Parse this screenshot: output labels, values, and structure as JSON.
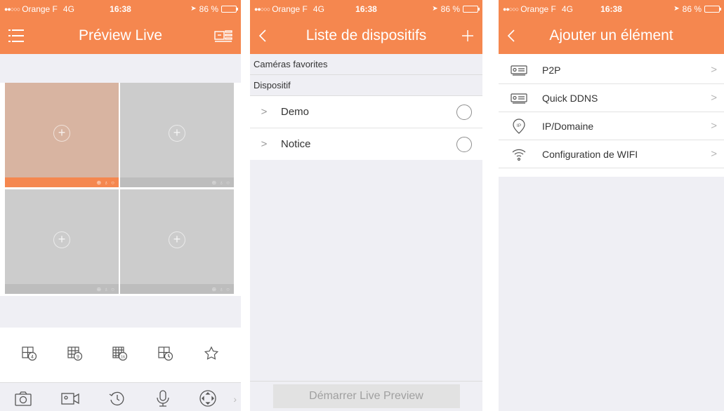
{
  "status": {
    "carrier": "Orange F",
    "network": "4G",
    "time": "16:38",
    "battery": "86 %",
    "signal_dots": "●●○○○"
  },
  "screen1": {
    "title": "Préview Live",
    "menu_icon": "list-menu-icon",
    "right_icon": "device-list-icon",
    "tiles": [
      {
        "add": "+",
        "active": true
      },
      {
        "add": "+",
        "active": false
      },
      {
        "add": "+",
        "active": false
      },
      {
        "add": "+",
        "active": false
      }
    ],
    "layout_icons": [
      "4",
      "9",
      "16",
      "clock",
      "star"
    ],
    "tools": [
      "camera-icon",
      "record-icon",
      "playback-icon",
      "microphone-icon",
      "ptz-icon"
    ],
    "more": "›"
  },
  "screen2": {
    "title": "Liste de dispositifs",
    "back": "<",
    "add": "+",
    "sections": [
      "Caméras favorites",
      "Dispositif"
    ],
    "devices": [
      {
        "name": "Demo",
        "chevron": ">"
      },
      {
        "name": "Notice",
        "chevron": ">"
      }
    ],
    "start_button": "Démarrer Live Preview"
  },
  "screen3": {
    "title": "Ajouter un élément",
    "back": "<",
    "items": [
      {
        "label": "P2P",
        "icon": "dvr-icon",
        "chevron": ">"
      },
      {
        "label": "Quick DDNS",
        "icon": "dvr-icon",
        "chevron": ">"
      },
      {
        "label": "IP/Domaine",
        "icon": "ip-pin-icon",
        "chevron": ">"
      },
      {
        "label": "Configuration de WIFI",
        "icon": "wifi-icon",
        "chevron": ">"
      }
    ]
  },
  "colors": {
    "accent": "#f5874f",
    "background": "#efeff4",
    "tile": "#cccccc",
    "active_tile": "#d8b4a1"
  }
}
